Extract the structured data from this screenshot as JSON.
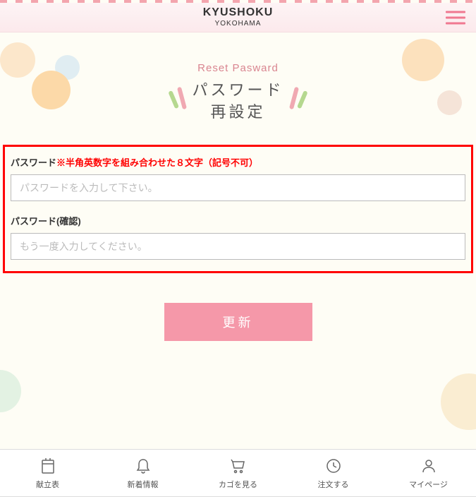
{
  "header": {
    "logo_main": "KYUSHOKU",
    "logo_sub": "YOKOHAMA"
  },
  "title": {
    "english": "Reset Pasward",
    "japanese_line1": "パスワード",
    "japanese_line2": "再設定"
  },
  "form": {
    "password_label": "パスワード",
    "password_hint": "※半角英数字を組み合わせた８文字（記号不可）",
    "password_placeholder": "パスワードを入力して下さい。",
    "password_confirm_label": "パスワード(確認)",
    "password_confirm_placeholder": "もう一度入力してください。",
    "submit_label": "更新"
  },
  "nav": {
    "item1": "献立表",
    "item2": "新着情報",
    "item3": "カゴを見る",
    "item4": "注文する",
    "item5": "マイページ"
  }
}
